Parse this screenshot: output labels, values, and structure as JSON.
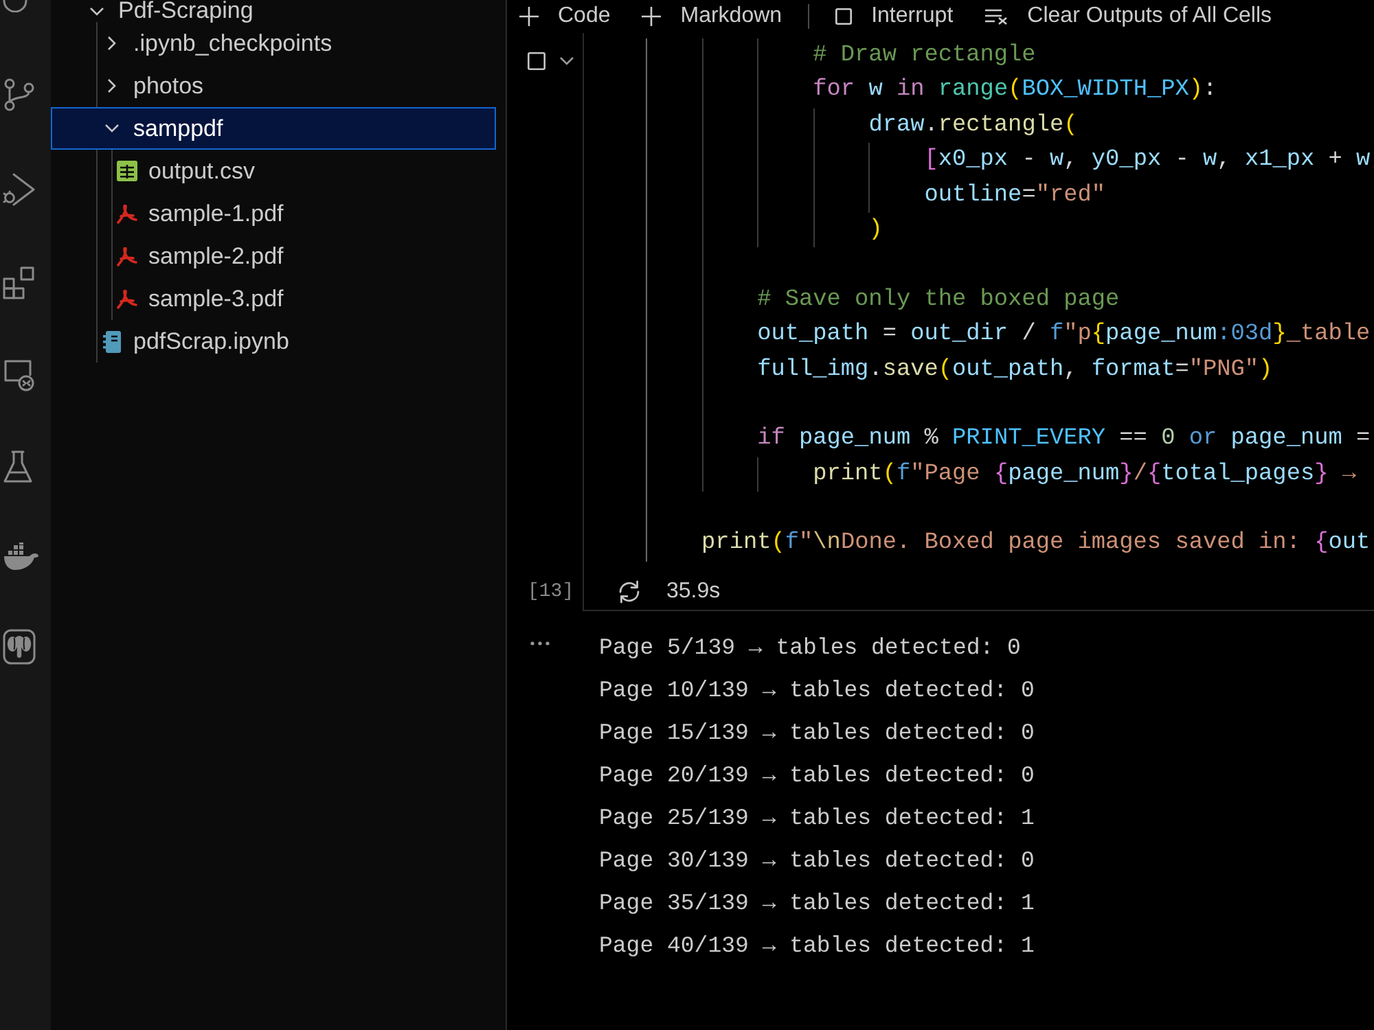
{
  "explorer": {
    "tree": [
      {
        "label": "Pdf-Scraping",
        "kind": "folder",
        "expanded": true,
        "selected": false,
        "children": [
          {
            "label": ".ipynb_checkpoints",
            "kind": "folder",
            "expanded": false,
            "selected": false
          },
          {
            "label": "photos",
            "kind": "folder",
            "expanded": false,
            "selected": false
          },
          {
            "label": "samppdf",
            "kind": "folder",
            "expanded": true,
            "selected": true,
            "children": [
              {
                "label": "output.csv",
                "kind": "csv",
                "selected": false
              },
              {
                "label": "sample-1.pdf",
                "kind": "pdf",
                "selected": false
              },
              {
                "label": "sample-2.pdf",
                "kind": "pdf",
                "selected": false
              },
              {
                "label": "sample-3.pdf",
                "kind": "pdf",
                "selected": false
              }
            ]
          },
          {
            "label": "pdfScrap.ipynb",
            "kind": "notebook",
            "selected": false
          }
        ]
      }
    ]
  },
  "toolbar": {
    "items": [
      {
        "kind": "add",
        "label": "Code"
      },
      {
        "kind": "add",
        "label": "Markdown"
      },
      {
        "kind": "separator"
      },
      {
        "kind": "interrupt",
        "label": "Interrupt"
      },
      {
        "kind": "clear",
        "label": "Clear Outputs of All Cells"
      }
    ]
  },
  "cell": {
    "code": [
      {
        "kind": "group",
        "children": [
          {
            "kind": "group",
            "children": [
              {
                "kind": "group",
                "children": [
                  {
                    "kind": "line",
                    "tokens": [
                      {
                        "kind": "comment",
                        "text": "# Draw rectangle"
                      }
                    ]
                  },
                  {
                    "kind": "line",
                    "tokens": [
                      {
                        "kind": "keyword",
                        "text": "for"
                      },
                      {
                        "kind": "variable",
                        "text": " w"
                      },
                      {
                        "kind": "keyword",
                        "text": " in"
                      },
                      {
                        "kind": "builtin",
                        "text": " range"
                      },
                      {
                        "kind": "outerbracket",
                        "text": "("
                      },
                      {
                        "kind": "constant",
                        "text": "BOX_WIDTH_PX"
                      },
                      {
                        "kind": "outerbracket",
                        "text": ")"
                      },
                      {
                        "kind": "plain",
                        "text": ":"
                      }
                    ],
                    "children": [
                      {
                        "kind": "line",
                        "tokens": [
                          {
                            "kind": "variable",
                            "text": "draw"
                          },
                          {
                            "kind": "plain",
                            "text": "."
                          },
                          {
                            "kind": "function",
                            "text": "rectangle"
                          },
                          {
                            "kind": "outerbracket",
                            "text": "("
                          }
                        ],
                        "children": [
                          {
                            "kind": "line",
                            "tokens": [
                              {
                                "kind": "innerbracket",
                                "text": "["
                              },
                              {
                                "kind": "variable",
                                "text": "x0_px"
                              },
                              {
                                "kind": "plain",
                                "text": " - "
                              },
                              {
                                "kind": "variable",
                                "text": "w"
                              },
                              {
                                "kind": "plain",
                                "text": ", "
                              },
                              {
                                "kind": "variable",
                                "text": "y0_px"
                              },
                              {
                                "kind": "plain",
                                "text": " - "
                              },
                              {
                                "kind": "variable",
                                "text": "w"
                              },
                              {
                                "kind": "plain",
                                "text": ", "
                              },
                              {
                                "kind": "variable",
                                "text": "x1_px"
                              },
                              {
                                "kind": "plain",
                                "text": " + "
                              },
                              {
                                "kind": "variable",
                                "text": "w"
                              }
                            ]
                          },
                          {
                            "kind": "line",
                            "tokens": [
                              {
                                "kind": "variable",
                                "text": "outline"
                              },
                              {
                                "kind": "plain",
                                "text": "="
                              },
                              {
                                "kind": "string",
                                "text": "\"red\""
                              }
                            ]
                          }
                        ]
                      },
                      {
                        "kind": "line",
                        "tokens": [
                          {
                            "kind": "outerbracket",
                            "text": ")"
                          }
                        ]
                      }
                    ]
                  }
                ]
              },
              {
                "kind": "blank"
              },
              {
                "kind": "line",
                "tokens": [
                  {
                    "kind": "comment",
                    "text": "# Save only the boxed page"
                  }
                ]
              },
              {
                "kind": "line",
                "tokens": [
                  {
                    "kind": "variable",
                    "text": "out_path"
                  },
                  {
                    "kind": "plain",
                    "text": " = "
                  },
                  {
                    "kind": "variable",
                    "text": "out_dir"
                  },
                  {
                    "kind": "plain",
                    "text": " / "
                  },
                  {
                    "kind": "prefix",
                    "text": "f"
                  },
                  {
                    "kind": "string",
                    "text": "\"p"
                  },
                  {
                    "kind": "outerbracket",
                    "text": "{"
                  },
                  {
                    "kind": "variable",
                    "text": "page_num"
                  },
                  {
                    "kind": "spec",
                    "text": ":03d"
                  },
                  {
                    "kind": "outerbracket",
                    "text": "}"
                  },
                  {
                    "kind": "string",
                    "text": "_table"
                  }
                ]
              },
              {
                "kind": "line",
                "tokens": [
                  {
                    "kind": "variable",
                    "text": "full_img"
                  },
                  {
                    "kind": "plain",
                    "text": "."
                  },
                  {
                    "kind": "function",
                    "text": "save"
                  },
                  {
                    "kind": "outerbracket",
                    "text": "("
                  },
                  {
                    "kind": "variable",
                    "text": "out_path"
                  },
                  {
                    "kind": "plain",
                    "text": ", "
                  },
                  {
                    "kind": "variable",
                    "text": "format"
                  },
                  {
                    "kind": "plain",
                    "text": "="
                  },
                  {
                    "kind": "string",
                    "text": "\"PNG\""
                  },
                  {
                    "kind": "outerbracket",
                    "text": ")"
                  }
                ]
              },
              {
                "kind": "blank"
              },
              {
                "kind": "line",
                "tokens": [
                  {
                    "kind": "keyword",
                    "text": "if"
                  },
                  {
                    "kind": "variable",
                    "text": " page_num"
                  },
                  {
                    "kind": "plain",
                    "text": " % "
                  },
                  {
                    "kind": "constant",
                    "text": "PRINT_EVERY"
                  },
                  {
                    "kind": "plain",
                    "text": " == "
                  },
                  {
                    "kind": "number",
                    "text": "0"
                  },
                  {
                    "kind": "logic",
                    "text": " or"
                  },
                  {
                    "kind": "variable",
                    "text": " page_num"
                  },
                  {
                    "kind": "plain",
                    "text": " ="
                  }
                ],
                "children": [
                  {
                    "kind": "line",
                    "tokens": [
                      {
                        "kind": "function",
                        "text": "print"
                      },
                      {
                        "kind": "outerbracket",
                        "text": "("
                      },
                      {
                        "kind": "prefix",
                        "text": "f"
                      },
                      {
                        "kind": "string",
                        "text": "\"Page "
                      },
                      {
                        "kind": "innerbracket",
                        "text": "{"
                      },
                      {
                        "kind": "variable",
                        "text": "page_num"
                      },
                      {
                        "kind": "innerbracket",
                        "text": "}"
                      },
                      {
                        "kind": "string",
                        "text": "/"
                      },
                      {
                        "kind": "innerbracket",
                        "text": "{"
                      },
                      {
                        "kind": "variable",
                        "text": "total_pages"
                      },
                      {
                        "kind": "innerbracket",
                        "text": "}"
                      },
                      {
                        "kind": "string",
                        "text": " →"
                      }
                    ]
                  }
                ]
              }
            ]
          },
          {
            "kind": "blank"
          },
          {
            "kind": "line",
            "tokens": [
              {
                "kind": "function",
                "text": "print"
              },
              {
                "kind": "outerbracket",
                "text": "("
              },
              {
                "kind": "prefix",
                "text": "f"
              },
              {
                "kind": "string",
                "text": "\""
              },
              {
                "kind": "escape",
                "text": "\\n"
              },
              {
                "kind": "string",
                "text": "Done. Boxed page images saved in: "
              },
              {
                "kind": "innerbracket",
                "text": "{"
              },
              {
                "kind": "variable",
                "text": "out"
              }
            ]
          }
        ]
      }
    ],
    "execution_count": "[13]",
    "duration": "35.9s"
  },
  "output": {
    "lines": [
      "Page 5/139 → tables detected: 0",
      "Page 10/139 → tables detected: 0",
      "Page 15/139 → tables detected: 0",
      "Page 20/139 → tables detected: 0",
      "Page 25/139 → tables detected: 1",
      "Page 30/139 → tables detected: 0",
      "Page 35/139 → tables detected: 1",
      "Page 40/139 → tables detected: 1"
    ]
  }
}
